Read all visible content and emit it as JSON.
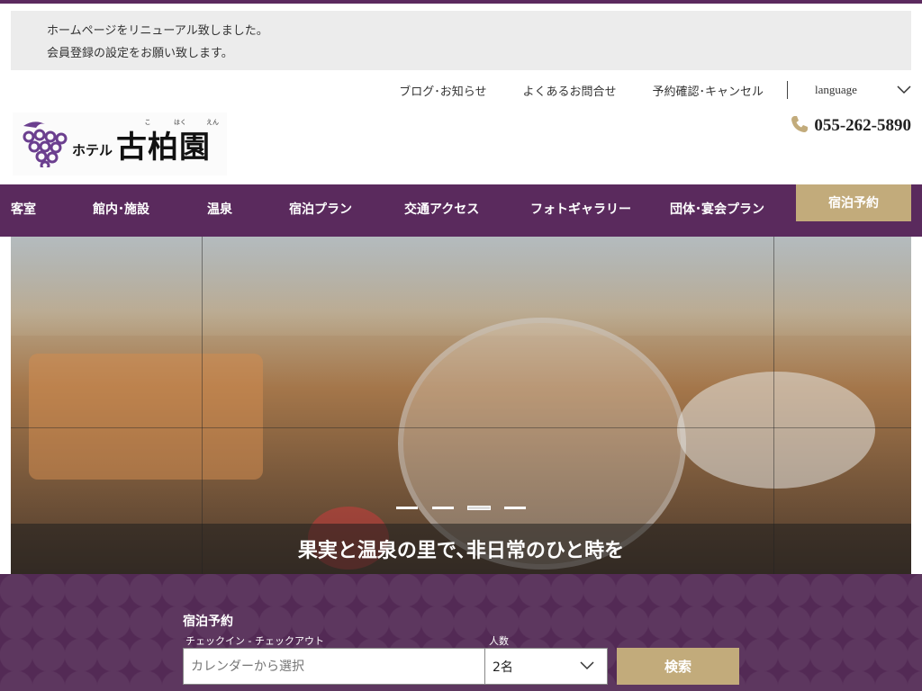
{
  "notice": {
    "line1": "ホームページをリニューアル致しました。",
    "line2": "会員登録の設定をお願い致します。"
  },
  "util_nav": {
    "blog": "ブログ･お知らせ",
    "faq": "よくあるお問合せ",
    "reservation_check": "予約確認･キャンセル",
    "language": "language"
  },
  "logo": {
    "furigana": [
      "こ",
      "はく",
      "えん"
    ],
    "prefix": "ホテル",
    "name": "古柏園"
  },
  "phone": {
    "number": "055-262-5890",
    "icon": "phone-icon"
  },
  "main_nav": {
    "items": [
      "客室",
      "館内･施設",
      "温泉",
      "宿泊プラン",
      "交通アクセス",
      "フォトギャラリー",
      "団体･宴会プラン"
    ],
    "reserve": "宿泊予約"
  },
  "hero": {
    "caption": "果実と温泉の里で､非日常のひと時を",
    "slides": 4,
    "active_slide": 3
  },
  "booking": {
    "title": "宿泊予約",
    "dates_label": "チェックイン - チェックアウト",
    "dates_placeholder": "カレンダーから選択",
    "people_label": "人数",
    "people_value": "2名",
    "search": "検索"
  },
  "colors": {
    "brand_purple": "#5a2a5d",
    "accent_gold": "#c2ab7b"
  }
}
